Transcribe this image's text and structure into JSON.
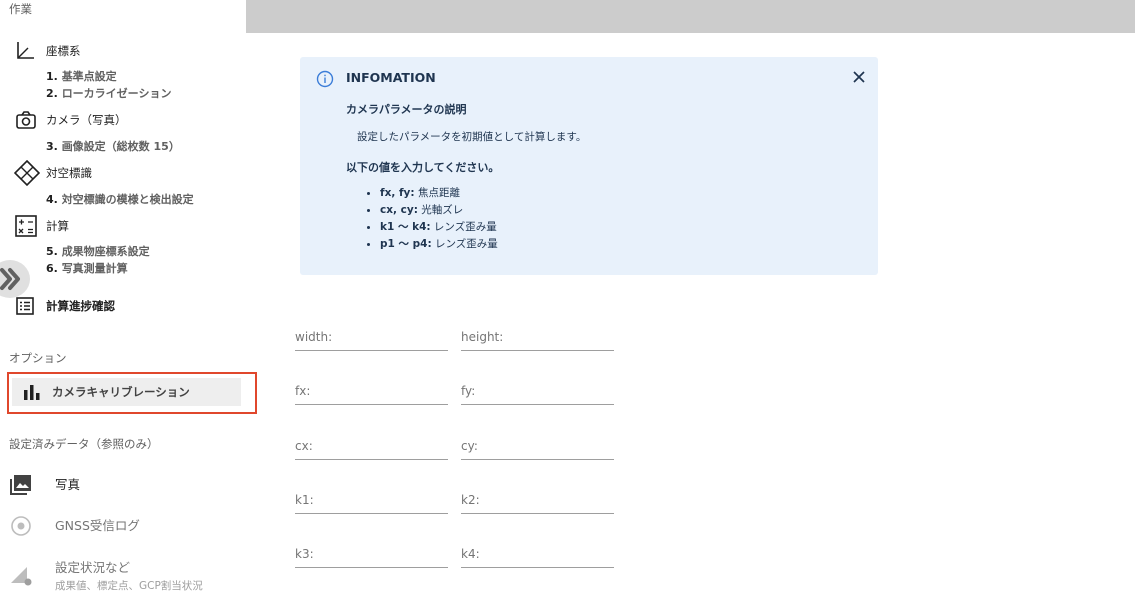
{
  "sidebar": {
    "work_title": "作業",
    "groups": [
      {
        "icon": "axes-icon",
        "label": "座標系",
        "subs": [
          {
            "num": "1.",
            "label": "基準点設定"
          },
          {
            "num": "2.",
            "label": "ローカライゼーション"
          }
        ]
      },
      {
        "icon": "camera-icon",
        "label": "カメラ（写真）",
        "subs": [
          {
            "num": "3.",
            "label": "画像設定（総枚数 15）"
          }
        ]
      },
      {
        "icon": "target-marker-icon",
        "label": "対空標識",
        "subs": [
          {
            "num": "4.",
            "label": "対空標識の模様と検出設定"
          }
        ]
      },
      {
        "icon": "calculator-icon",
        "label": "計算",
        "subs": [
          {
            "num": "5.",
            "label": "成果物座標系設定"
          },
          {
            "num": "6.",
            "label": "写真測量計算"
          }
        ]
      },
      {
        "icon": "list-icon",
        "label": "計算進捗確認",
        "subs": []
      }
    ],
    "options_title": "オプション",
    "calibration_label": "カメラキャリブレーション",
    "data_title": "設定済みデータ（参照のみ）",
    "data_items": [
      {
        "icon": "photo-library-icon",
        "label": "写真",
        "sub": ""
      },
      {
        "icon": "gnss-icon",
        "label": "GNSS受信ログ",
        "sub": ""
      },
      {
        "icon": "settings-status-icon",
        "label": "設定状況など",
        "sub": "成果値、標定点、GCP割当状況"
      }
    ]
  },
  "info": {
    "title": "INFOMATION",
    "heading1": "カメラパラメータの説明",
    "text1": "設定したパラメータを初期値として計算します。",
    "heading2": "以下の値を入力してください。",
    "items": [
      {
        "key": "fx, fy:",
        "desc": " 焦点距離"
      },
      {
        "key": "cx, cy:",
        "desc": " 光軸ズレ"
      },
      {
        "key": "k1 〜 k4:",
        "desc": " レンズ歪み量"
      },
      {
        "key": "p1 〜 p4:",
        "desc": " レンズ歪み量"
      }
    ]
  },
  "form": {
    "fields": [
      {
        "label": "width:",
        "value": ""
      },
      {
        "label": "height:",
        "value": ""
      },
      {
        "label": "fx:",
        "value": ""
      },
      {
        "label": "fy:",
        "value": ""
      },
      {
        "label": "cx:",
        "value": ""
      },
      {
        "label": "cy:",
        "value": ""
      },
      {
        "label": "k1:",
        "value": ""
      },
      {
        "label": "k2:",
        "value": ""
      },
      {
        "label": "k3:",
        "value": ""
      },
      {
        "label": "k4:",
        "value": ""
      }
    ]
  },
  "colors": {
    "highlight": "#e0472c",
    "info_bg": "#e8f1fb",
    "info_text": "#1f3550",
    "topbar": "#cccccc"
  }
}
